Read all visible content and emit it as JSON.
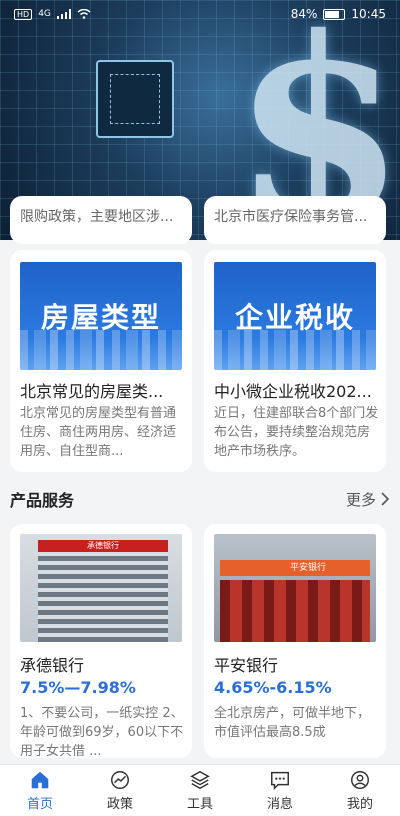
{
  "status_bar": {
    "hd_badge": "HD",
    "signal": "4G",
    "battery": "84%",
    "time": "10:45"
  },
  "partial_cards": [
    {
      "text": "限购政策，主要地区涉..."
    },
    {
      "text": "北京市医疗保险事务管..."
    }
  ],
  "news": [
    {
      "image_text": "房屋类型",
      "title": "北京常见的房屋类...",
      "desc": "北京常见的房屋类型有普通住房、商住两用房、经济适用房、自住型商..."
    },
    {
      "image_text": "企业税收",
      "title": "中小微企业税收202...",
      "desc": "近日，住建部联合8个部门发布公告，要持续整治规范房地产市场秩序。"
    }
  ],
  "section": {
    "title": "产品服务",
    "more": "更多"
  },
  "products": [
    {
      "name": "承德银行",
      "rate": "7.5%—7.98%",
      "desc": "1、不要公司，一纸实控 2、年龄可做到69岁，60以下不用子女共借 ...",
      "sign": "承德银行"
    },
    {
      "name": "平安银行",
      "rate": "4.65%-6.15%",
      "desc": "全北京房产，可做半地下，市值评估最高8.5成",
      "sign": "平安银行"
    }
  ],
  "tabs": [
    {
      "label": "首页",
      "active": true
    },
    {
      "label": "政策",
      "active": false
    },
    {
      "label": "工具",
      "active": false
    },
    {
      "label": "消息",
      "active": false
    },
    {
      "label": "我的",
      "active": false
    }
  ],
  "colors": {
    "accent": "#2a6fd6",
    "rate": "#2a6fd6",
    "banner_blue": "#2b7ae0"
  }
}
